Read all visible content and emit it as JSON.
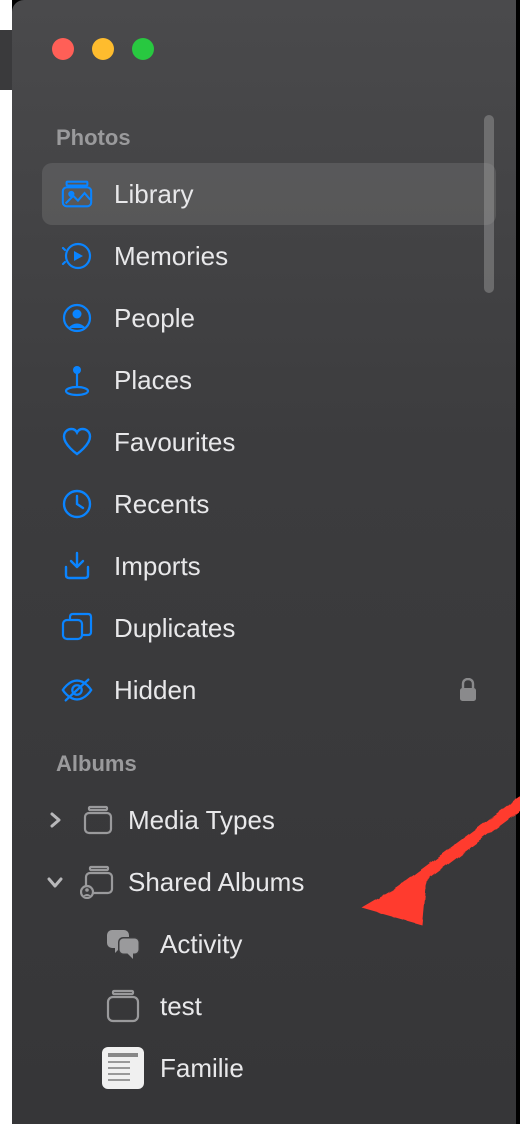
{
  "sections": {
    "photos": {
      "header": "Photos",
      "items": [
        {
          "label": "Library",
          "icon": "library",
          "selected": true
        },
        {
          "label": "Memories",
          "icon": "memories"
        },
        {
          "label": "People",
          "icon": "people"
        },
        {
          "label": "Places",
          "icon": "places"
        },
        {
          "label": "Favourites",
          "icon": "heart"
        },
        {
          "label": "Recents",
          "icon": "clock"
        },
        {
          "label": "Imports",
          "icon": "import"
        },
        {
          "label": "Duplicates",
          "icon": "duplicates"
        },
        {
          "label": "Hidden",
          "icon": "hidden",
          "locked": true
        }
      ]
    },
    "albums": {
      "header": "Albums",
      "items": [
        {
          "label": "Media Types",
          "disclosure": "closed"
        },
        {
          "label": "Shared Albums",
          "disclosure": "open",
          "children": [
            {
              "label": "Activity",
              "icon": "activity"
            },
            {
              "label": "test",
              "icon": "stack"
            },
            {
              "label": "Familie",
              "icon": "thumb"
            }
          ]
        }
      ]
    }
  },
  "colors": {
    "accent": "#0a84ff",
    "muted": "#9a9a9c"
  }
}
